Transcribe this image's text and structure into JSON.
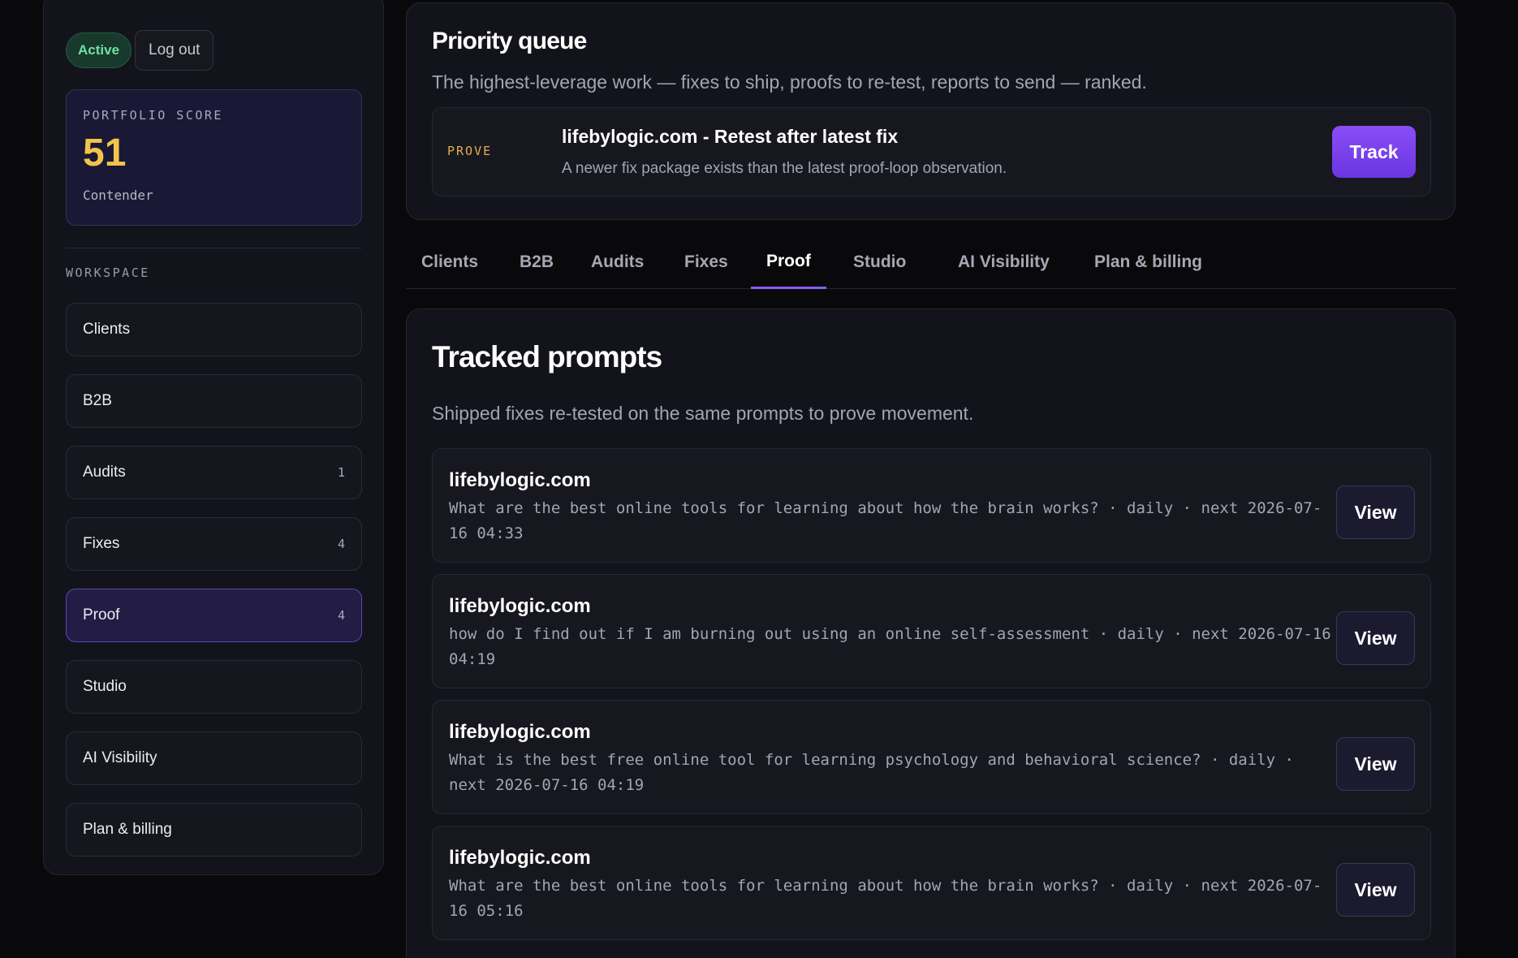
{
  "sidebar": {
    "status_badge": "Active",
    "logout_label": "Log out",
    "score": {
      "label": "PORTFOLIO SCORE",
      "value": "51",
      "tier": "Contender"
    },
    "workspace_label": "WORKSPACE",
    "items": [
      {
        "label": "Clients",
        "count": ""
      },
      {
        "label": "B2B",
        "count": ""
      },
      {
        "label": "Audits",
        "count": "1"
      },
      {
        "label": "Fixes",
        "count": "4"
      },
      {
        "label": "Proof",
        "count": "4",
        "active": true
      },
      {
        "label": "Studio",
        "count": ""
      },
      {
        "label": "AI Visibility",
        "count": ""
      },
      {
        "label": "Plan & billing",
        "count": ""
      }
    ]
  },
  "priority_queue": {
    "title": "Priority queue",
    "subtitle": "The highest-leverage work — fixes to ship, proofs to re-test, reports to send — ranked.",
    "card": {
      "tag": "PROVE",
      "heading": "lifebylogic.com - Retest after latest fix",
      "description": "A newer fix package exists than the latest proof-loop observation.",
      "action_label": "Track"
    }
  },
  "tabs": [
    "Clients",
    "B2B",
    "Audits",
    "Fixes",
    "Proof",
    "Studio",
    "AI Visibility",
    "Plan & billing"
  ],
  "active_tab": "Proof",
  "tracked_prompts": {
    "title": "Tracked prompts",
    "subtitle": "Shipped fixes re-tested on the same prompts to prove movement.",
    "view_label": "View",
    "items": [
      {
        "domain": "lifebylogic.com",
        "detail": "What are the best online tools for learning about how the brain works? · daily · next 2026-07-16 04:33"
      },
      {
        "domain": "lifebylogic.com",
        "detail": "how do I find out if I am burning out using an online self-assessment · daily · next 2026-07-16 04:19"
      },
      {
        "domain": "lifebylogic.com",
        "detail": "What is the best free online tool for learning psychology and behavioral science? · daily · next 2026-07-16 04:19"
      },
      {
        "domain": "lifebylogic.com",
        "detail": "What are the best online tools for learning about how the brain works? · daily · next 2026-07-16 05:16"
      }
    ]
  },
  "colors": {
    "accent": "#8b5cf6",
    "score": "#f3c44b",
    "active_badge": "#72dfa4",
    "prove_tag": "#e2b04c"
  }
}
